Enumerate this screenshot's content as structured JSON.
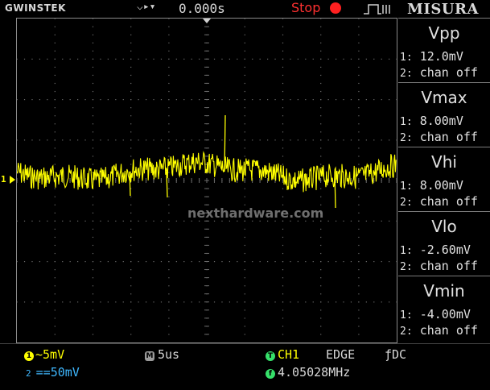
{
  "header": {
    "brand": "GWINSTEK",
    "delay": "0.000s",
    "status": "Stop",
    "label": "MISURA"
  },
  "waveform": {
    "channel_label": "1",
    "watermark": "nexthardware.com"
  },
  "measurements": [
    {
      "name": "Vpp",
      "ch1_prefix": "1:",
      "ch1_value": "12.0mV",
      "ch2_prefix": "2:",
      "ch2_value": "chan off"
    },
    {
      "name": "Vmax",
      "ch1_prefix": "1:",
      "ch1_value": "8.00mV",
      "ch2_prefix": "2:",
      "ch2_value": "chan off"
    },
    {
      "name": "Vhi",
      "ch1_prefix": "1:",
      "ch1_value": "8.00mV",
      "ch2_prefix": "2:",
      "ch2_value": "chan off"
    },
    {
      "name": "Vlo",
      "ch1_prefix": "1:",
      "ch1_value": "-2.60mV",
      "ch2_prefix": "2:",
      "ch2_value": "chan off"
    },
    {
      "name": "Vmin",
      "ch1_prefix": "1:",
      "ch1_value": "-4.00mV",
      "ch2_prefix": "2:",
      "ch2_value": "chan off"
    }
  ],
  "bottom": {
    "ch1_badge": "1",
    "ch1_coupling": "~",
    "ch1_scale": "5mV",
    "ch2_badge": "2",
    "ch2_coupling": "==",
    "ch2_scale": "50mV",
    "timebase_badge": "M",
    "timebase": "5us",
    "trigger_badge": "T",
    "trigger_source": "CH1",
    "trigger_type": "EDGE",
    "trigger_coupling": "DC",
    "freq_badge": "f",
    "frequency": "4.05028MHz"
  },
  "colors": {
    "ch1": "#ffff00",
    "ch2": "#3fb8ff",
    "status": "#ff3030",
    "grid": "#6a6a6a"
  }
}
